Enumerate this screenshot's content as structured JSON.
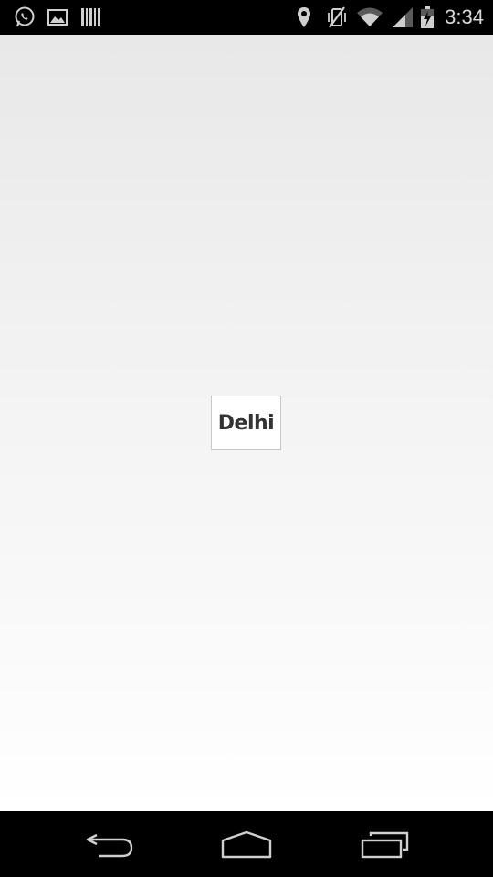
{
  "status_bar": {
    "time": "3:34",
    "icons": {
      "left": [
        "whatsapp-icon",
        "gallery-icon",
        "barcode-icon"
      ],
      "right": [
        "location-icon",
        "vibrate-off-icon",
        "wifi-icon",
        "signal-icon",
        "battery-charging-icon"
      ]
    }
  },
  "main": {
    "city_button_label": "Delhi"
  },
  "nav_bar": {
    "buttons": [
      "back-button",
      "home-button",
      "recent-apps-button"
    ]
  },
  "colors": {
    "status_bar_bg": "#000000",
    "nav_bar_bg": "#000000",
    "content_bg_top": "#e8e8e8",
    "content_bg_bottom": "#ffffff",
    "button_text": "#333333",
    "icon_color": "#cfcfcf"
  }
}
